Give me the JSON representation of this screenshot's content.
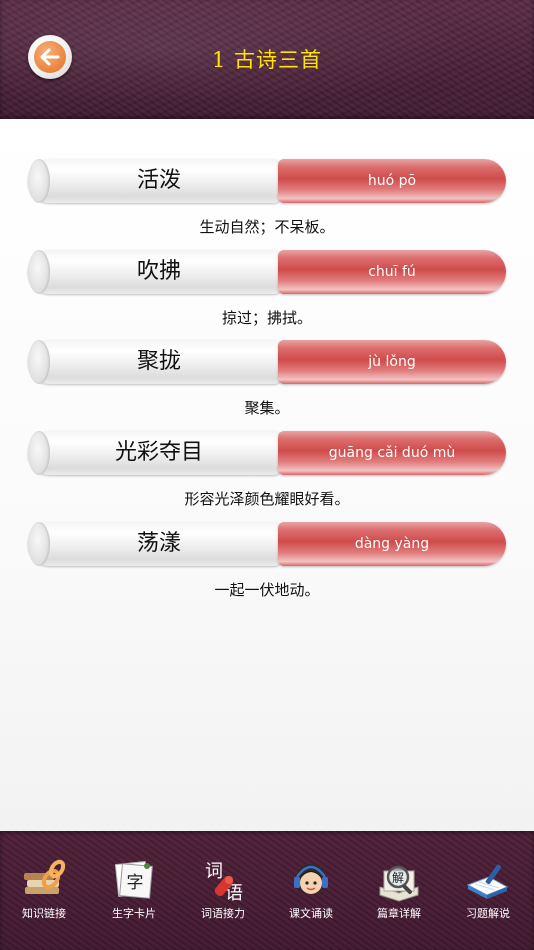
{
  "header": {
    "title": "1 古诗三首"
  },
  "entries": [
    {
      "word": "活泼",
      "pinyin": "huó pō",
      "meaning": "生动自然；不呆板。"
    },
    {
      "word": "吹拂",
      "pinyin": "chuī fú",
      "meaning": "掠过；拂拭。"
    },
    {
      "word": "聚拢",
      "pinyin": "jù lǒng",
      "meaning": "聚集。"
    },
    {
      "word": "光彩夺目",
      "pinyin": "guāng cǎi duó mù",
      "meaning": "形容光泽颜色耀眼好看。"
    },
    {
      "word": "荡漾",
      "pinyin": "dàng yàng",
      "meaning": "一起一伏地动。"
    }
  ],
  "toolbar": {
    "items": [
      {
        "label": "知识链接",
        "icon": "books-chain-icon"
      },
      {
        "label": "生字卡片",
        "icon": "character-card-icon",
        "glyph": "字"
      },
      {
        "label": "词语接力",
        "icon": "word-relay-icon",
        "glyph_top": "词",
        "glyph_bottom": "语"
      },
      {
        "label": "课文诵读",
        "icon": "reader-headphones-icon"
      },
      {
        "label": "篇章详解",
        "icon": "magnifier-book-icon",
        "glyph": "解"
      },
      {
        "label": "习题解说",
        "icon": "notebook-pen-icon"
      }
    ]
  },
  "colors": {
    "title": "#ffe400",
    "accent_red": "#cf4b4b",
    "back_orange": "#e9833d"
  }
}
